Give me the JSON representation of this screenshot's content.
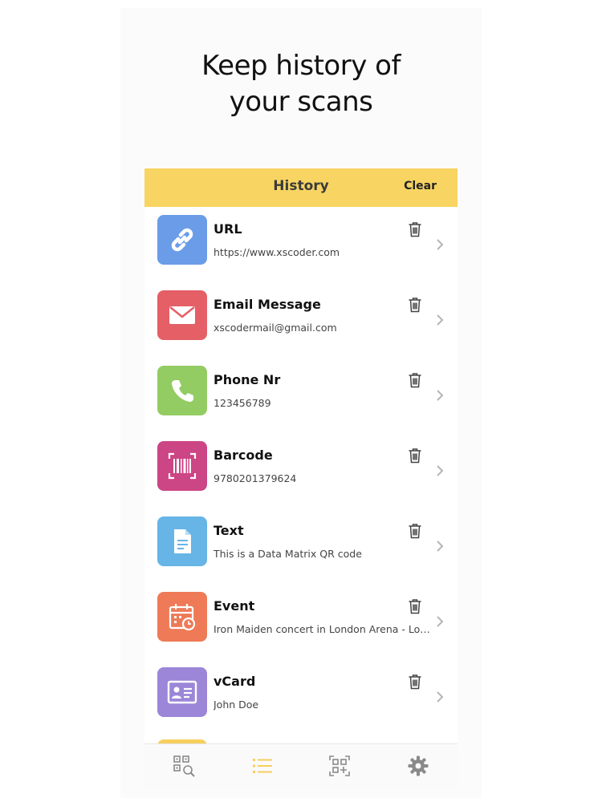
{
  "headline": {
    "line1": "Keep history of",
    "line2": "your scans"
  },
  "header": {
    "title": "History",
    "clear_label": "Clear",
    "color": "#f8d462"
  },
  "items": [
    {
      "icon": "link-icon",
      "color": "#6b9ce8",
      "title": "URL",
      "subtitle": "https://www.xscoder.com"
    },
    {
      "icon": "envelope-icon",
      "color": "#e45f66",
      "title": "Email Message",
      "subtitle": "xscodermail@gmail.com"
    },
    {
      "icon": "phone-icon",
      "color": "#93cc62",
      "title": "Phone Nr",
      "subtitle": "123456789"
    },
    {
      "icon": "barcode-icon",
      "color": "#cc4584",
      "title": "Barcode",
      "subtitle": "9780201379624"
    },
    {
      "icon": "document-icon",
      "color": "#66b5e6",
      "title": "Text",
      "subtitle": "This is a Data Matrix QR code"
    },
    {
      "icon": "calendar-icon",
      "color": "#ee7a57",
      "title": "Event",
      "subtitle": "Iron Maiden concert in London Arena - London, UK"
    },
    {
      "icon": "id-card-icon",
      "color": "#9b86d8",
      "title": "vCard",
      "subtitle": "John Doe"
    }
  ],
  "tabs": [
    {
      "icon": "qr-search-icon",
      "active": false
    },
    {
      "icon": "list-icon",
      "active": true
    },
    {
      "icon": "qr-add-icon",
      "active": false
    },
    {
      "icon": "gear-icon",
      "active": false
    }
  ],
  "colors": {
    "active_tab": "#f6cf5d",
    "inactive_tab": "#8a8a8a"
  }
}
